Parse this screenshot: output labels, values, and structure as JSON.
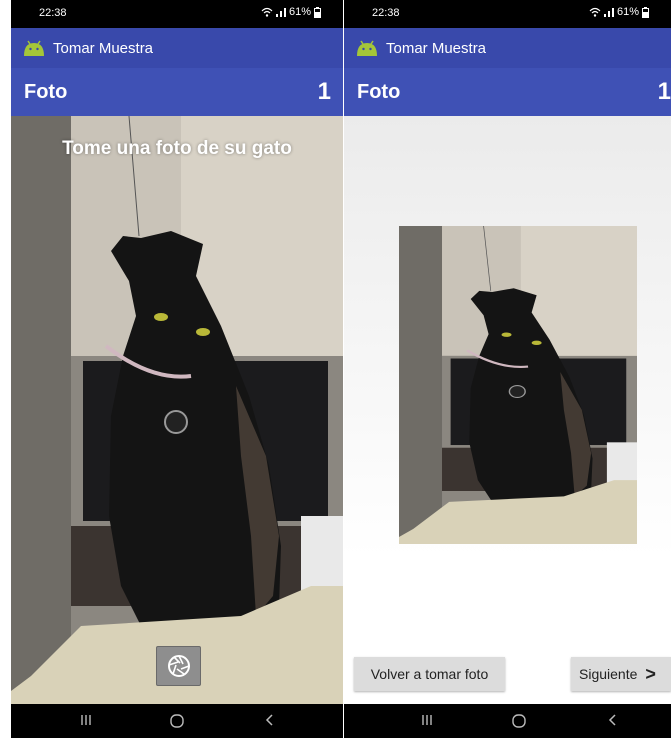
{
  "status_bar": {
    "time": "22:38",
    "battery": "61%"
  },
  "app_bar": {
    "title": "Tomar Muestra"
  },
  "section": {
    "title": "Foto",
    "count": "1"
  },
  "camera": {
    "prompt": "Tome una foto de su gato"
  },
  "preview": {
    "retake_label": "Volver a tomar foto",
    "next_label": "Siguiente",
    "next_chevron": ">"
  },
  "icons": [
    "wifi-icon",
    "signal-icon",
    "battery-icon",
    "android-icon",
    "shutter-icon",
    "recents-icon",
    "home-icon",
    "back-icon",
    "chevron-right-icon"
  ],
  "colors": {
    "app_bar": "#3949ab",
    "section_bar": "#3f51b5",
    "status_bar": "#000000",
    "button": "#dcdcdc"
  }
}
